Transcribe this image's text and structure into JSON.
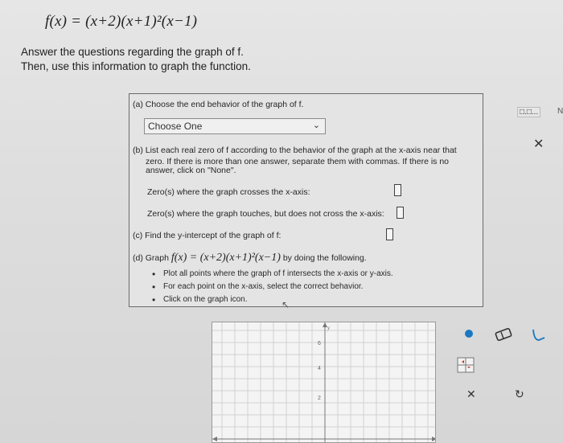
{
  "header": {
    "function": "f(x) = (x+2)(x+1)²(x−1)"
  },
  "intro": {
    "line1": "Answer the questions regarding the graph of f.",
    "line2": "Then, use this information to graph the function."
  },
  "panel": {
    "part_a": "(a) Choose the end behavior of the graph of f.",
    "dropdown_value": "Choose One",
    "part_b_line1": "(b) List each real zero of f according to the behavior of the graph at the x-axis near that",
    "part_b_line2": "zero. If there is more than one answer, separate them with commas. If there is no",
    "part_b_line3": "answer, click on \"None\".",
    "zeros_cross_label": "Zero(s) where the graph crosses the x-axis:",
    "zeros_touch_label": "Zero(s) where the graph touches, but does not cross the x-axis:",
    "part_c": "(c) Find the y-intercept of the graph of f:",
    "part_d_prefix": "(d) Graph ",
    "part_d_function": "f(x) = (x+2)(x+1)²(x−1)",
    "part_d_suffix": " by doing the following.",
    "bullets": [
      "Plot all points where the graph of f intersects the x-axis or y-axis.",
      "For each point on the x-axis, select the correct behavior.",
      "Click on the graph icon."
    ]
  },
  "side": {
    "menu_label": "□.□...",
    "edge_label": "N"
  },
  "graph": {
    "y_axis": "y",
    "ticks": [
      "6",
      "4",
      "2"
    ]
  },
  "colors": {
    "accent": "#1a78c2",
    "panel_border": "#6a6a6a",
    "background": "#dcdcdc"
  }
}
